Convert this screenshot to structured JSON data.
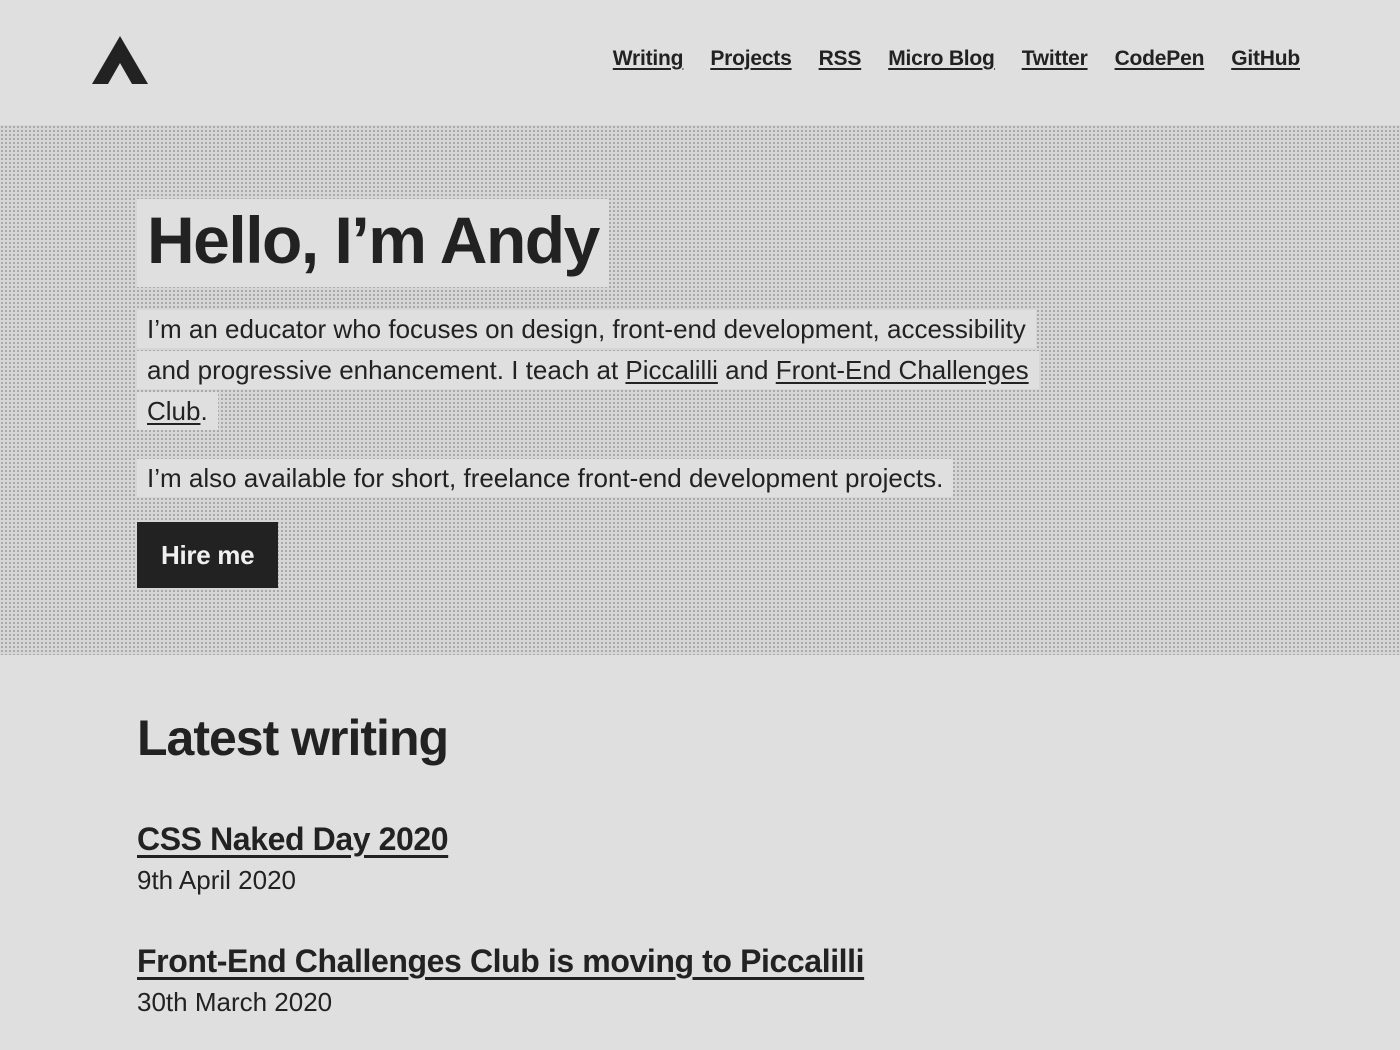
{
  "header": {
    "logo_icon": "triangle-a-logo-icon",
    "nav": [
      {
        "label": "Writing"
      },
      {
        "label": "Projects"
      },
      {
        "label": "RSS"
      },
      {
        "label": "Micro Blog"
      },
      {
        "label": "Twitter"
      },
      {
        "label": "CodePen"
      },
      {
        "label": "GitHub"
      }
    ]
  },
  "hero": {
    "title": "Hello, I’m Andy",
    "intro_before": "I’m an educator who focuses on design, front-end development, accessibility and progressive enhancement. I teach at ",
    "piccalilli_link": "Piccalilli",
    "intro_and": " and ",
    "fecc_link": "Front-End Challenges Club",
    "intro_end": ".",
    "freelance": "I’m also available for short, freelance front-end development projects.",
    "hire_button": "Hire me"
  },
  "latest": {
    "heading": "Latest writing",
    "posts": [
      {
        "title": "CSS Naked Day 2020",
        "date": "9th April 2020"
      },
      {
        "title": "Front-End Challenges Club is moving to Piccalilli",
        "date": "30th March 2020"
      }
    ]
  },
  "colors": {
    "background": "#dfdfdf",
    "text": "#222222",
    "button_bg": "#222222"
  }
}
